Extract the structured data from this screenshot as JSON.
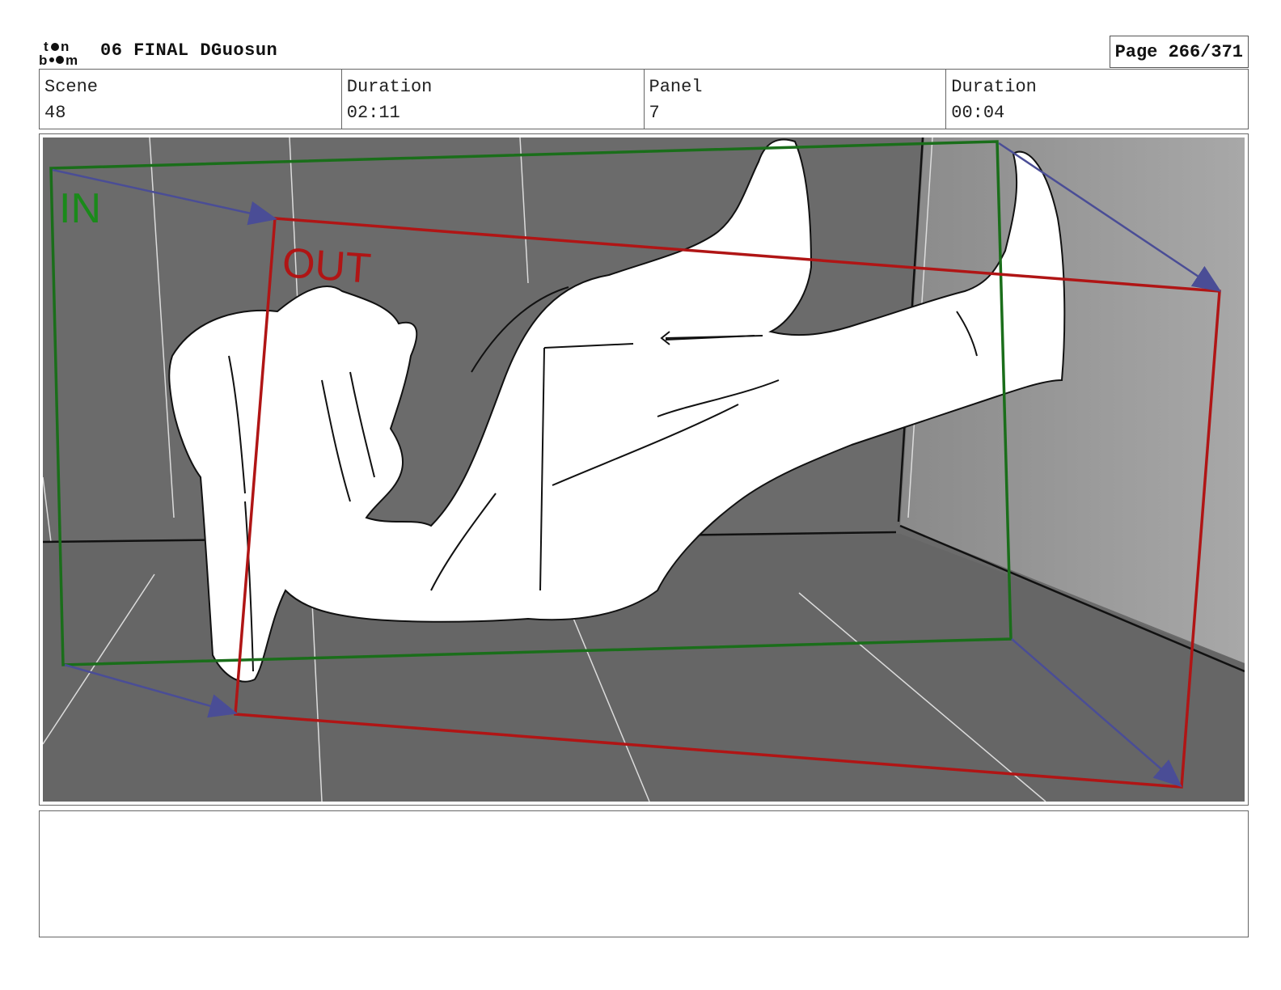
{
  "header": {
    "logo_text": "toon boom",
    "doc_title": "06 FINAL DGuosun",
    "page_label": "Page 266/371"
  },
  "info": {
    "scene_label": "Scene",
    "scene_value": "48",
    "duration_label": "Duration",
    "duration_value": "02:11",
    "panel_label": "Panel",
    "panel_value": "7",
    "panel_duration_label": "Duration",
    "panel_duration_value": "00:04"
  },
  "panel": {
    "in_label": "IN",
    "out_label": "OUT",
    "colors": {
      "in_frame": "#1a6e1a",
      "out_frame": "#b01515",
      "arrows": "#4a4d96",
      "background": "#6b6b6b"
    }
  },
  "notes": {
    "text": ""
  }
}
